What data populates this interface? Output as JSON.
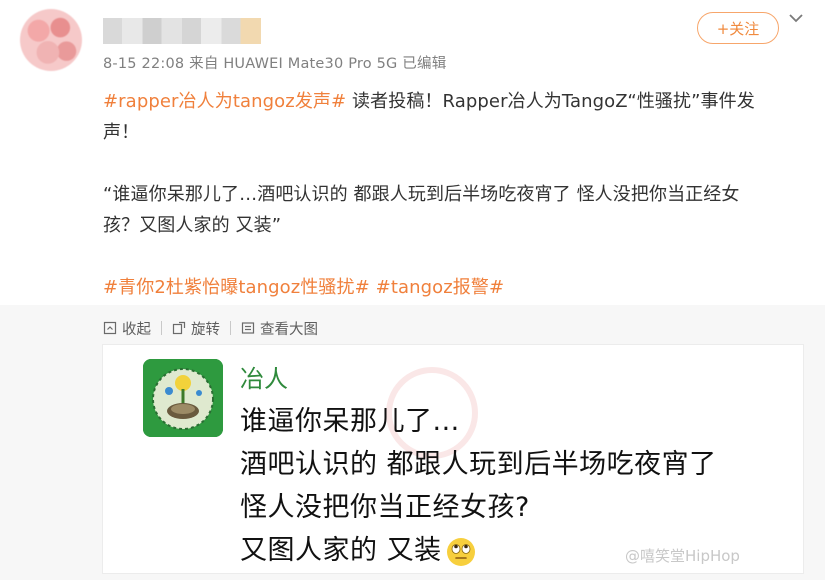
{
  "post": {
    "meta": "8-15 22:08 来自 HUAWEI Mate30 Pro 5G 已编辑",
    "follow_label": "+关注",
    "content": {
      "line1_tag": "#rapper冶人为tangoz发声#",
      "line1_text": " 读者投稿！Rapper冶人为TangoZ“性骚扰”事件发",
      "line2_text": "声！",
      "quote_line1": "“谁逼你呆那儿了…酒吧认识的 都跟人玩到后半场吃夜宵了 怪人没把你当正经女",
      "quote_line2": "孩？又图人家的 又装”",
      "tag2": "#青你2杜紫怡曝tangoz性骚扰#",
      "tag3": "#tangoz报警#"
    }
  },
  "actions": {
    "collapse": "收起",
    "rotate": "旋转",
    "view_large": "查看大图"
  },
  "screenshot": {
    "sender_name": "冶人",
    "lines": [
      "谁逼你呆那儿了...",
      "酒吧认识的 都跟人玩到后半场吃夜宵了",
      "怪人没把你当正经女孩?",
      "又图人家的 又装"
    ]
  },
  "watermark": "@嘻笑堂HipHop",
  "colors": {
    "accent": "#f0803c",
    "chat_name": "#2f8a3c",
    "text": "#333333"
  }
}
